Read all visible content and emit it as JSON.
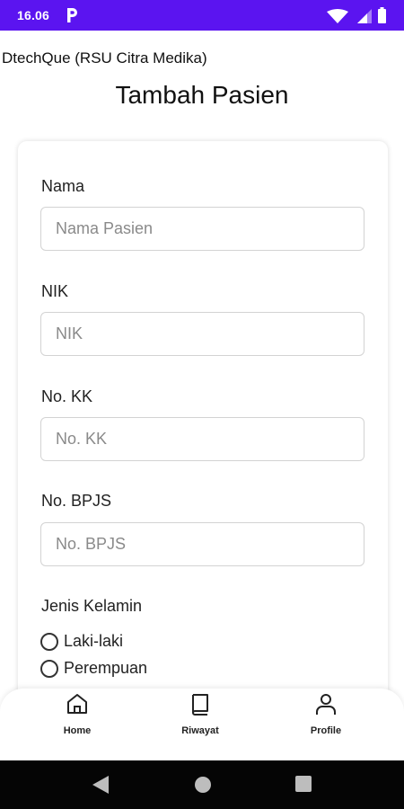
{
  "status_bar": {
    "time": "16.06",
    "app_icon": "parking-p-icon",
    "wifi_icon": "wifi-icon",
    "signal_icon": "cell-signal-icon",
    "battery_icon": "battery-icon",
    "background_color": "#5b14f0"
  },
  "header": {
    "app_title": "DtechQue (RSU Citra Medika)",
    "page_title": "Tambah Pasien"
  },
  "form": {
    "fields": [
      {
        "label": "Nama",
        "placeholder": "Nama Pasien",
        "value": ""
      },
      {
        "label": "NIK",
        "placeholder": "NIK",
        "value": ""
      },
      {
        "label": "No. KK",
        "placeholder": "No. KK",
        "value": ""
      },
      {
        "label": "No. BPJS",
        "placeholder": "No. BPJS",
        "value": ""
      }
    ],
    "gender": {
      "label": "Jenis Kelamin",
      "options": [
        "Laki-laki",
        "Perempuan"
      ],
      "selected": null
    }
  },
  "bottom_nav": {
    "items": [
      {
        "label": "Home",
        "icon": "home-icon"
      },
      {
        "label": "Riwayat",
        "icon": "book-icon"
      },
      {
        "label": "Profile",
        "icon": "user-icon"
      }
    ]
  },
  "system_nav": {
    "back_icon": "back-triangle-icon",
    "home_icon": "home-circle-icon",
    "recents_icon": "recents-square-icon"
  }
}
